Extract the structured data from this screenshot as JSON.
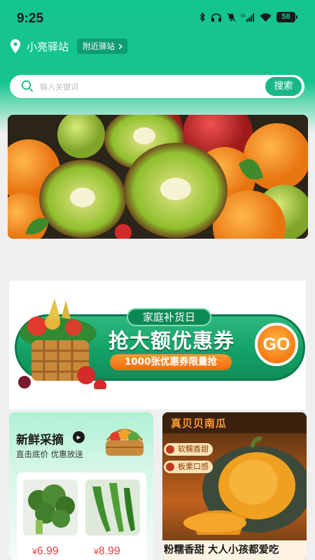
{
  "status_bar": {
    "time": "9:25",
    "battery": "58"
  },
  "location": {
    "name": "小亮驿站",
    "nearby_label": "附近驿站"
  },
  "search": {
    "placeholder": "输入关键词",
    "button_label": "搜索"
  },
  "promo": {
    "tag": "家庭补货日",
    "title": "抢大额优惠券",
    "subtitle": "1000张优惠券限量抢",
    "go_label": "GO"
  },
  "fresh_card": {
    "title": "新鲜采摘",
    "subtitle": "直击底价 优惠放送",
    "products": [
      {
        "name": "broccoli",
        "price_symbol": "¥",
        "price": "6.99"
      },
      {
        "name": "green-pepper",
        "price_symbol": "¥",
        "price": "8.99"
      }
    ]
  },
  "pumpkin_card": {
    "header": "真贝贝南瓜",
    "tags": [
      "软糯香甜",
      "板栗口感"
    ],
    "bottom_text": "粉糯香甜  大人小孩都爱吃"
  },
  "colors": {
    "brand_green": "#19b886",
    "price_red": "#f03c3c",
    "go_orange": "#f57c12"
  }
}
